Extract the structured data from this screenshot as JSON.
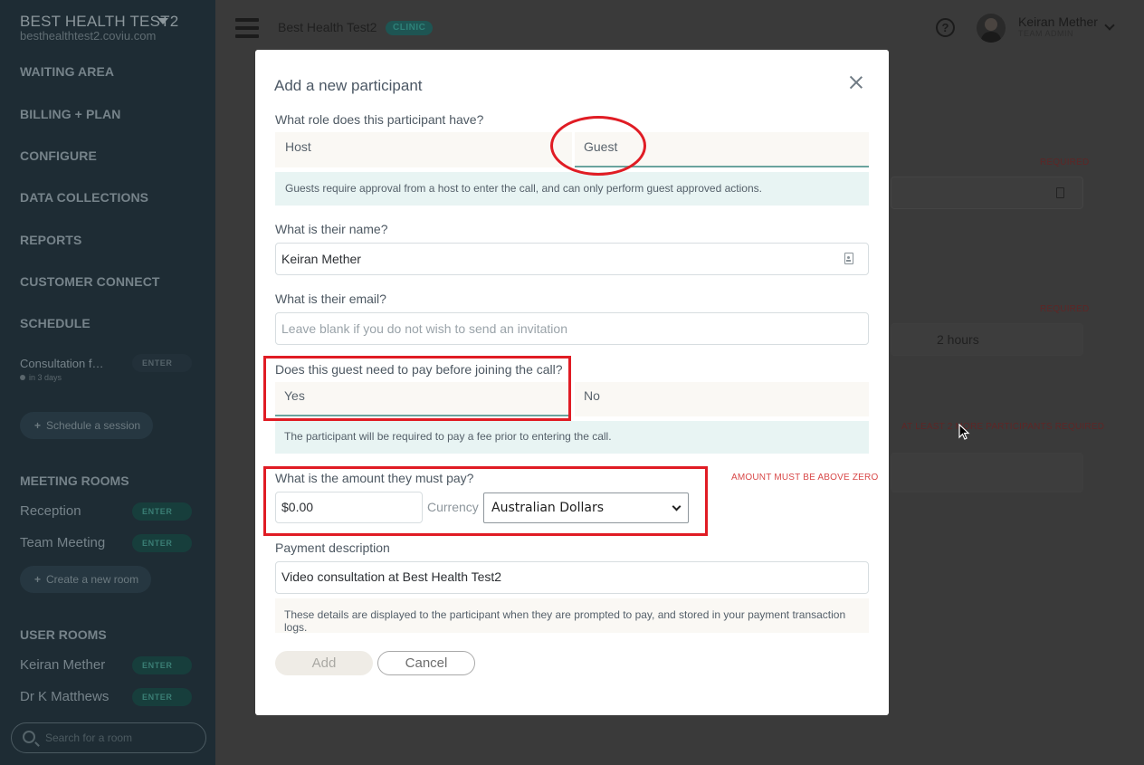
{
  "sidebar": {
    "org_name": "BEST HEALTH TEST2",
    "org_url": "besthealthtest2.coviu.com",
    "nav": [
      "WAITING AREA",
      "BILLING + PLAN",
      "CONFIGURE",
      "DATA COLLECTIONS",
      "REPORTS",
      "CUSTOMER CONNECT",
      "SCHEDULE"
    ],
    "session": {
      "title": "Consultation f…",
      "sub": "in 3 days",
      "enter": "ENTER"
    },
    "schedule_button": "Schedule a session",
    "meeting_rooms_heading": "MEETING ROOMS",
    "meeting_rooms": [
      {
        "name": "Reception",
        "enter": "ENTER"
      },
      {
        "name": "Team Meeting",
        "enter": "ENTER"
      }
    ],
    "create_room_button": "Create a new room",
    "user_rooms_heading": "USER ROOMS",
    "user_rooms": [
      {
        "name": "Keiran Mether",
        "enter": "ENTER"
      },
      {
        "name": "Dr K Matthews",
        "enter": "ENTER"
      }
    ],
    "search_placeholder": "Search for a room"
  },
  "topbar": {
    "title": "Best Health Test2",
    "badge": "CLINIC",
    "user_name": "Keiran Mether",
    "user_role": "TEAM ADMIN"
  },
  "background": {
    "required_1": "REQUIRED",
    "required_2": "REQUIRED",
    "duration": "2 hours",
    "participants_required": "AT LEAST 2 MORE PARTICIPANTS REQUIRED"
  },
  "modal": {
    "title": "Add a new participant",
    "role_question": "What role does this participant have?",
    "role_options": [
      "Host",
      "Guest"
    ],
    "role_selected": "Guest",
    "role_info": "Guests require approval from a host to enter the call, and can only perform guest approved actions.",
    "name_label": "What is their name?",
    "name_value": "Keiran Mether",
    "email_label": "What is their email?",
    "email_placeholder": "Leave blank if you do not wish to send an invitation",
    "pay_question": "Does this guest need to pay before joining the call?",
    "pay_options": [
      "Yes",
      "No"
    ],
    "pay_selected": "Yes",
    "pay_info": "The participant will be required to pay a fee prior to entering the call.",
    "amount_label": "What is the amount they must pay?",
    "amount_error": "AMOUNT MUST BE ABOVE ZERO",
    "amount_value": "$0.00",
    "currency_label": "Currency",
    "currency_value": "Australian Dollars",
    "description_label": "Payment description",
    "description_value": "Video consultation at Best Health Test2",
    "description_info": "These details are displayed to the participant when they are prompted to pay, and stored in your payment transaction logs.",
    "add_button": "Add",
    "cancel_button": "Cancel"
  },
  "colors": {
    "accent": "#6aa49e",
    "annotation": "#e01c24",
    "error": "#d84848"
  }
}
